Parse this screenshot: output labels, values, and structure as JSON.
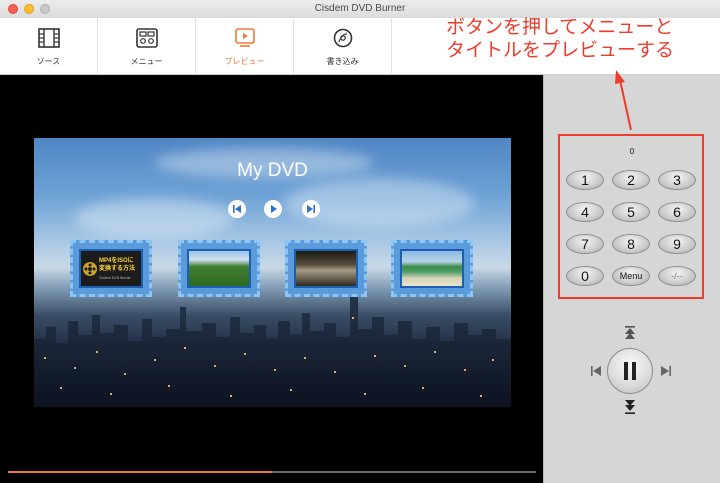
{
  "window": {
    "title": "Cisdem DVD Burner"
  },
  "toolbar": {
    "items": [
      {
        "label": "ソース",
        "icon": "film-icon",
        "active": false
      },
      {
        "label": "メニュー",
        "icon": "menu-template-icon",
        "active": false
      },
      {
        "label": "プレビュー",
        "icon": "play-preview-icon",
        "active": true
      },
      {
        "label": "書き込み",
        "icon": "disc-burn-icon",
        "active": false
      }
    ]
  },
  "annotation": {
    "line1": "ボタンを押してメニューと",
    "line2": "タイトルをプレビューする"
  },
  "preview": {
    "dvd_title": "My DVD",
    "thumbnail_1_text_line1": "MP4をISOに",
    "thumbnail_1_text_line2": "変換する方法",
    "thumbnail_1_sub": "Cisdem DVD Burner",
    "progress_fraction": 0.5
  },
  "remote": {
    "display_value": "0",
    "keys": [
      "1",
      "2",
      "3",
      "4",
      "5",
      "6",
      "7",
      "8",
      "9",
      "0",
      "Menu",
      "-/--"
    ]
  },
  "colors": {
    "accent": "#f07a3a",
    "annotation": "#ef3b2a",
    "thumb_frame": "#5b9bdb"
  }
}
